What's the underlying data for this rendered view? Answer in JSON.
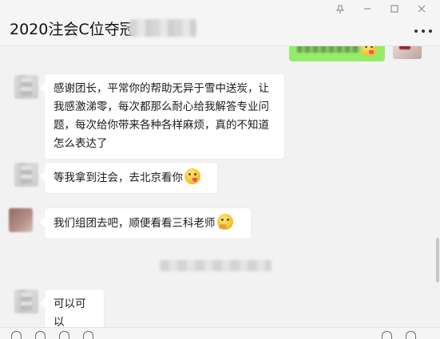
{
  "window": {
    "pin_icon": "pin-icon",
    "minimize_icon": "minimize-icon",
    "maximize_icon": "maximize-icon",
    "close_icon": "close-icon"
  },
  "header": {
    "title": "2020注会C位夺冠",
    "more_icon": "more-icon"
  },
  "messages": [
    {
      "sender": "other",
      "text": "感谢团长，平常你的帮助无异于雪中送炭，让我感激涕零，每次都那么耐心给我解答专业问题，每次给你带来各种各样麻烦，真的不知道怎么表达了",
      "lines": [
        "感谢团长，平常你的帮助无异于雪中送炭，让",
        "我感激涕零，每次都那么耐心给我解答专业问",
        "题，每次给你带来各种各样麻烦，真的不知道",
        "怎么表达了"
      ]
    },
    {
      "sender": "other",
      "text": "等我拿到注会，去北京看你",
      "emoji": "yum-face"
    },
    {
      "sender": "other",
      "text": "我们组团去吧，顺便看看三科老师",
      "emoji": "thinking-face"
    },
    {
      "sender": "other",
      "text": "可以可以"
    }
  ],
  "colors": {
    "background": "#f2f2f2",
    "bubble_in": "#ffffff",
    "bubble_out": "#95ec69"
  }
}
